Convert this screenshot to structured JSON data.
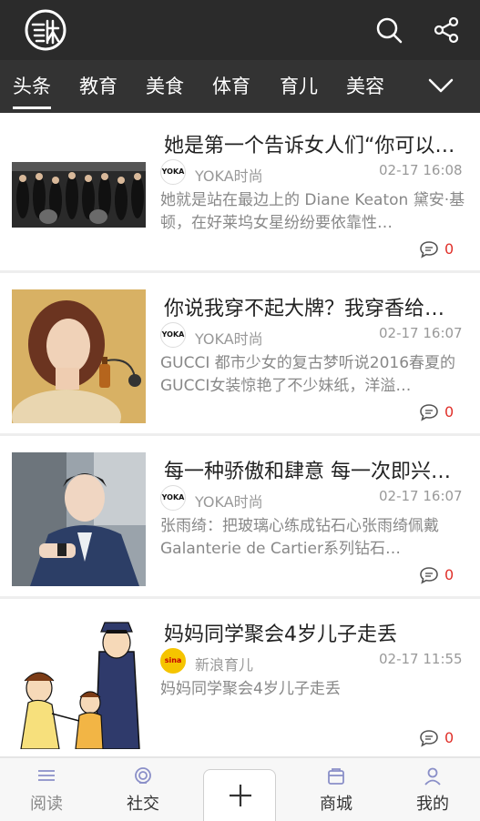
{
  "app": {
    "logo_text": "乐味"
  },
  "tabs": [
    {
      "label": "头条",
      "active": true
    },
    {
      "label": "教育",
      "active": false
    },
    {
      "label": "美食",
      "active": false
    },
    {
      "label": "体育",
      "active": false
    },
    {
      "label": "育儿",
      "active": false
    },
    {
      "label": "美容",
      "active": false
    }
  ],
  "articles": [
    {
      "title": "她是第一个告诉女人们“你可以…",
      "source": "YOKA时尚",
      "source_logo": "YOKA",
      "time": "02-17 16:08",
      "desc": "她就是站在最边上的 Diane Keaton 黛安·基顿，在好莱坞女星纷纷要依靠性…",
      "comments": "0"
    },
    {
      "title": "你说我穿不起大牌？我穿香给…",
      "source": "YOKA时尚",
      "source_logo": "YOKA",
      "time": "02-17 16:07",
      "desc": "GUCCI 都市少女的复古梦听说2016春夏的GUCCI女装惊艳了不少妹纸，洋溢…",
      "comments": "0"
    },
    {
      "title": "每一种骄傲和肆意 每一次即兴…",
      "source": "YOKA时尚",
      "source_logo": "YOKA",
      "time": "02-17 16:07",
      "desc": "张雨绮：把玻璃心练成钻石心张雨绮佩戴Galanterie de Cartier系列钻石…",
      "comments": "0"
    },
    {
      "title": "妈妈同学聚会4岁儿子走丢",
      "source": "新浪育儿",
      "source_logo": "sina",
      "time": "02-17 11:55",
      "desc": "妈妈同学聚会4岁儿子走丢",
      "comments": "0"
    }
  ],
  "bottom_nav": [
    {
      "label": "阅读",
      "icon": "read-icon"
    },
    {
      "label": "社交",
      "icon": "social-icon"
    },
    {
      "label": "商城",
      "icon": "mall-icon"
    },
    {
      "label": "我的",
      "icon": "profile-icon"
    }
  ],
  "colors": {
    "topbar": "#2b2b2b",
    "tabbar": "#333333",
    "comment_count": "#e0302a"
  }
}
